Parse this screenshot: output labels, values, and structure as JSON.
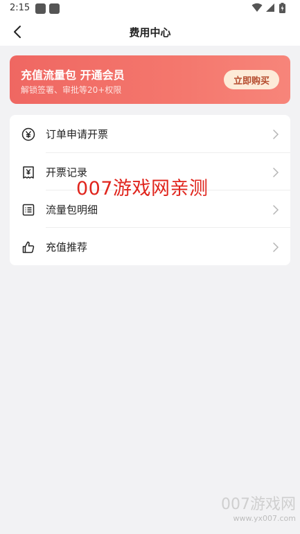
{
  "status_bar": {
    "time": "2:15"
  },
  "header": {
    "title": "费用中心"
  },
  "banner": {
    "title": "充值流量包 开通会员",
    "subtitle": "解锁签署、审批等20+权限",
    "button_label": "立即购买"
  },
  "menu": {
    "items": [
      {
        "label": "订单申请开票",
        "icon": "yen-circle-icon"
      },
      {
        "label": "开票记录",
        "icon": "invoice-icon"
      },
      {
        "label": "流量包明细",
        "icon": "list-icon"
      },
      {
        "label": "充值推荐",
        "icon": "thumbs-up-icon"
      }
    ]
  },
  "watermark": {
    "center_text": "007游戏网亲测",
    "corner_text": "007游戏网",
    "corner_url": "www.yx007.com"
  },
  "colors": {
    "banner_accent": "#ef6762",
    "buy_button_bg": "#fdebd8",
    "watermark_red": "#e0251d"
  }
}
